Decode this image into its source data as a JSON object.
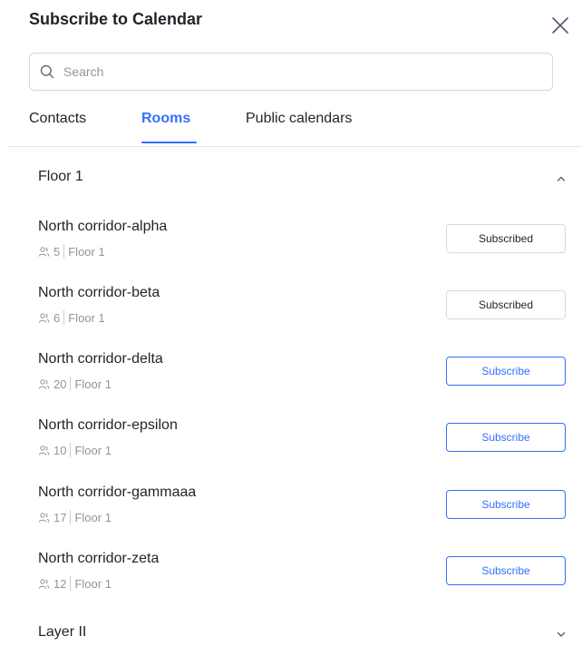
{
  "dialog": {
    "title": "Subscribe to Calendar"
  },
  "search": {
    "placeholder": "Search"
  },
  "tabs": [
    {
      "label": "Contacts",
      "active": false
    },
    {
      "label": "Rooms",
      "active": true
    },
    {
      "label": "Public calendars",
      "active": false
    }
  ],
  "groups": [
    {
      "title": "Floor 1",
      "expanded": true,
      "rooms": [
        {
          "name": "North corridor-alpha",
          "capacity": "5",
          "location": "Floor 1",
          "button": "Subscribed",
          "state": "subscribed"
        },
        {
          "name": "North corridor-beta",
          "capacity": "6",
          "location": "Floor 1",
          "button": "Subscribed",
          "state": "subscribed"
        },
        {
          "name": "North corridor-delta",
          "capacity": "20",
          "location": "Floor 1",
          "button": "Subscribe",
          "state": "subscribe"
        },
        {
          "name": "North corridor-epsilon",
          "capacity": "10",
          "location": "Floor 1",
          "button": "Subscribe",
          "state": "subscribe"
        },
        {
          "name": "North corridor-gammaaa",
          "capacity": "17",
          "location": "Floor 1",
          "button": "Subscribe",
          "state": "subscribe"
        },
        {
          "name": "North corridor-zeta",
          "capacity": "12",
          "location": "Floor 1",
          "button": "Subscribe",
          "state": "subscribe"
        }
      ]
    },
    {
      "title": "Layer II",
      "expanded": false,
      "rooms": []
    }
  ],
  "colors": {
    "accent": "#3370ff",
    "text": "#1f2329",
    "muted": "#8f959e",
    "border": "#d5d8de"
  },
  "icons": {
    "close": "close-icon",
    "search": "search-icon",
    "people": "people-icon",
    "collapse": "chevron-up-icon",
    "expand": "chevron-down-icon"
  }
}
